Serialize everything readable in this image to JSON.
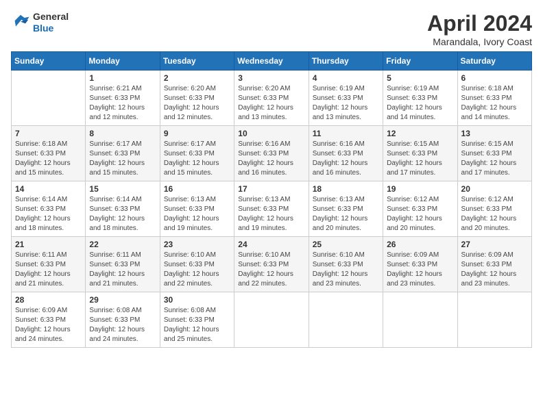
{
  "logo": {
    "general": "General",
    "blue": "Blue"
  },
  "title": "April 2024",
  "subtitle": "Marandala, Ivory Coast",
  "days_header": [
    "Sunday",
    "Monday",
    "Tuesday",
    "Wednesday",
    "Thursday",
    "Friday",
    "Saturday"
  ],
  "weeks": [
    [
      {
        "day": "",
        "info": ""
      },
      {
        "day": "1",
        "info": "Sunrise: 6:21 AM\nSunset: 6:33 PM\nDaylight: 12 hours\nand 12 minutes."
      },
      {
        "day": "2",
        "info": "Sunrise: 6:20 AM\nSunset: 6:33 PM\nDaylight: 12 hours\nand 12 minutes."
      },
      {
        "day": "3",
        "info": "Sunrise: 6:20 AM\nSunset: 6:33 PM\nDaylight: 12 hours\nand 13 minutes."
      },
      {
        "day": "4",
        "info": "Sunrise: 6:19 AM\nSunset: 6:33 PM\nDaylight: 12 hours\nand 13 minutes."
      },
      {
        "day": "5",
        "info": "Sunrise: 6:19 AM\nSunset: 6:33 PM\nDaylight: 12 hours\nand 14 minutes."
      },
      {
        "day": "6",
        "info": "Sunrise: 6:18 AM\nSunset: 6:33 PM\nDaylight: 12 hours\nand 14 minutes."
      }
    ],
    [
      {
        "day": "7",
        "info": "Sunrise: 6:18 AM\nSunset: 6:33 PM\nDaylight: 12 hours\nand 15 minutes."
      },
      {
        "day": "8",
        "info": "Sunrise: 6:17 AM\nSunset: 6:33 PM\nDaylight: 12 hours\nand 15 minutes."
      },
      {
        "day": "9",
        "info": "Sunrise: 6:17 AM\nSunset: 6:33 PM\nDaylight: 12 hours\nand 15 minutes."
      },
      {
        "day": "10",
        "info": "Sunrise: 6:16 AM\nSunset: 6:33 PM\nDaylight: 12 hours\nand 16 minutes."
      },
      {
        "day": "11",
        "info": "Sunrise: 6:16 AM\nSunset: 6:33 PM\nDaylight: 12 hours\nand 16 minutes."
      },
      {
        "day": "12",
        "info": "Sunrise: 6:15 AM\nSunset: 6:33 PM\nDaylight: 12 hours\nand 17 minutes."
      },
      {
        "day": "13",
        "info": "Sunrise: 6:15 AM\nSunset: 6:33 PM\nDaylight: 12 hours\nand 17 minutes."
      }
    ],
    [
      {
        "day": "14",
        "info": "Sunrise: 6:14 AM\nSunset: 6:33 PM\nDaylight: 12 hours\nand 18 minutes."
      },
      {
        "day": "15",
        "info": "Sunrise: 6:14 AM\nSunset: 6:33 PM\nDaylight: 12 hours\nand 18 minutes."
      },
      {
        "day": "16",
        "info": "Sunrise: 6:13 AM\nSunset: 6:33 PM\nDaylight: 12 hours\nand 19 minutes."
      },
      {
        "day": "17",
        "info": "Sunrise: 6:13 AM\nSunset: 6:33 PM\nDaylight: 12 hours\nand 19 minutes."
      },
      {
        "day": "18",
        "info": "Sunrise: 6:13 AM\nSunset: 6:33 PM\nDaylight: 12 hours\nand 20 minutes."
      },
      {
        "day": "19",
        "info": "Sunrise: 6:12 AM\nSunset: 6:33 PM\nDaylight: 12 hours\nand 20 minutes."
      },
      {
        "day": "20",
        "info": "Sunrise: 6:12 AM\nSunset: 6:33 PM\nDaylight: 12 hours\nand 20 minutes."
      }
    ],
    [
      {
        "day": "21",
        "info": "Sunrise: 6:11 AM\nSunset: 6:33 PM\nDaylight: 12 hours\nand 21 minutes."
      },
      {
        "day": "22",
        "info": "Sunrise: 6:11 AM\nSunset: 6:33 PM\nDaylight: 12 hours\nand 21 minutes."
      },
      {
        "day": "23",
        "info": "Sunrise: 6:10 AM\nSunset: 6:33 PM\nDaylight: 12 hours\nand 22 minutes."
      },
      {
        "day": "24",
        "info": "Sunrise: 6:10 AM\nSunset: 6:33 PM\nDaylight: 12 hours\nand 22 minutes."
      },
      {
        "day": "25",
        "info": "Sunrise: 6:10 AM\nSunset: 6:33 PM\nDaylight: 12 hours\nand 23 minutes."
      },
      {
        "day": "26",
        "info": "Sunrise: 6:09 AM\nSunset: 6:33 PM\nDaylight: 12 hours\nand 23 minutes."
      },
      {
        "day": "27",
        "info": "Sunrise: 6:09 AM\nSunset: 6:33 PM\nDaylight: 12 hours\nand 23 minutes."
      }
    ],
    [
      {
        "day": "28",
        "info": "Sunrise: 6:09 AM\nSunset: 6:33 PM\nDaylight: 12 hours\nand 24 minutes."
      },
      {
        "day": "29",
        "info": "Sunrise: 6:08 AM\nSunset: 6:33 PM\nDaylight: 12 hours\nand 24 minutes."
      },
      {
        "day": "30",
        "info": "Sunrise: 6:08 AM\nSunset: 6:33 PM\nDaylight: 12 hours\nand 25 minutes."
      },
      {
        "day": "",
        "info": ""
      },
      {
        "day": "",
        "info": ""
      },
      {
        "day": "",
        "info": ""
      },
      {
        "day": "",
        "info": ""
      }
    ]
  ]
}
